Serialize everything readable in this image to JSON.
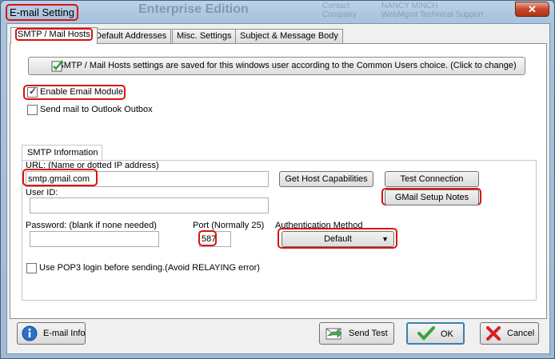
{
  "window": {
    "title": "E-mail Setting",
    "close_glyph": "✕",
    "background_text": "Enterprise Edition",
    "background_fields": [
      "Contact",
      "Company",
      "NANCY MINCH",
      "WebMgmt Technical Support"
    ]
  },
  "tabs": [
    {
      "label": "SMTP / Mail Hosts",
      "active": true
    },
    {
      "label": "Default Addresses",
      "active": false
    },
    {
      "label": "Misc. Settings",
      "active": false
    },
    {
      "label": "Subject & Message Body",
      "active": false
    }
  ],
  "banner": {
    "text": "SMTP / Mail Hosts settings are saved for this windows user according to the Common Users choice.   (Click to change)",
    "icon": "green-check-icon"
  },
  "options": {
    "enable_email": {
      "label": "Enable Email Module",
      "checked": true
    },
    "outlook_outbox": {
      "label": "Send mail to Outlook Outbox",
      "checked": false
    },
    "pop3": {
      "label": "Use POP3 login before sending.(Avoid RELAYING error)",
      "checked": false
    }
  },
  "smtp": {
    "group_title": "SMTP Information",
    "url_label": "URL:  (Name or dotted IP address)",
    "url_value": "smtp.gmail.com",
    "userid_label": "User ID:",
    "userid_value": "",
    "password_label": "Password:  (blank if none needed)",
    "password_value": "",
    "port_label": "Port (Normally 25)",
    "port_value": "587",
    "auth_label": "Authentication Method",
    "auth_value": "Default",
    "get_host_button": "Get Host Capabilities",
    "test_connection_button": "Test Connection",
    "gmail_notes_button": "GMail Setup Notes"
  },
  "footer": {
    "email_info": "E-mail Info",
    "send_test": "Send Test",
    "ok": "OK",
    "cancel": "Cancel"
  },
  "colors": {
    "annotation_red": "#dd1111",
    "ok_check_green": "#3aa33a",
    "cancel_x_red": "#d62020"
  }
}
